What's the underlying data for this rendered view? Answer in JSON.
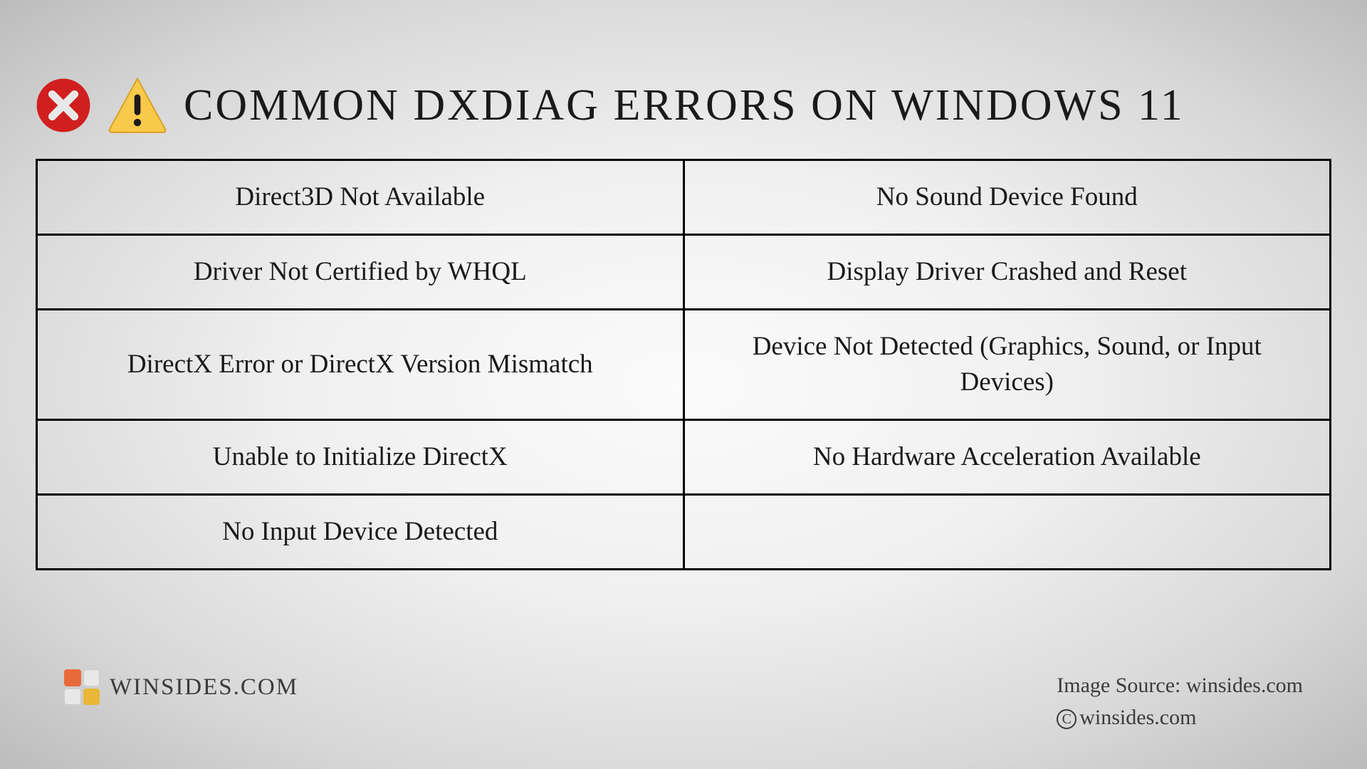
{
  "title": "COMMON DXDIAG ERRORS ON WINDOWS 11",
  "table": {
    "rows": [
      {
        "left": "Direct3D Not Available",
        "right": "No Sound Device Found"
      },
      {
        "left": "Driver Not Certified by WHQL",
        "right": "Display Driver Crashed and Reset"
      },
      {
        "left": "DirectX Error or DirectX Version Mismatch",
        "right": "Device Not Detected (Graphics, Sound, or Input Devices)"
      },
      {
        "left": "Unable to Initialize DirectX",
        "right": "No Hardware Acceleration Available"
      },
      {
        "left": "No Input Device Detected",
        "right": ""
      }
    ]
  },
  "footer": {
    "brand": "WINSIDES.COM",
    "source_label": "Image Source: winsides.com",
    "copyright": "winsides.com"
  }
}
